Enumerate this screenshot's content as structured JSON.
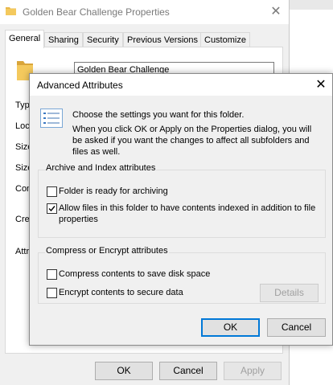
{
  "background_window": {
    "title": "Golden Bear Challenge Properties",
    "close_glyph": "✕",
    "tabs": [
      "General",
      "Sharing",
      "Security",
      "Previous Versions",
      "Customize"
    ],
    "active_tab": "General",
    "folder_name": "Golden Bear Challenge",
    "side_labels": [
      "Typ",
      "Loc",
      "Size",
      "Size",
      "Con",
      "Cre",
      "Attr"
    ],
    "buttons": {
      "ok": "OK",
      "cancel": "Cancel",
      "apply": "Apply"
    }
  },
  "dialog": {
    "title": "Advanced Attributes",
    "close_glyph": "✕",
    "intro_line1": "Choose the settings you want for this folder.",
    "intro_line2": "When you click OK or Apply on the Properties dialog, you will be asked if you want the changes to affect all subfolders and files as well.",
    "archive_group": {
      "label": "Archive and Index attributes",
      "archive_label": "Folder is ready for archiving",
      "archive_checked": false,
      "index_label": "Allow files in this folder to have contents indexed in addition to file properties",
      "index_checked": true
    },
    "compress_group": {
      "label": "Compress or Encrypt attributes",
      "compress_label": "Compress contents to save disk space",
      "compress_checked": false,
      "encrypt_label": "Encrypt contents to secure data",
      "encrypt_checked": false,
      "details_label": "Details"
    },
    "ok_label": "OK",
    "cancel_label": "Cancel"
  },
  "colors": {
    "accent": "#0078d7",
    "folder": "#e8b84a",
    "window_bg": "#f0f0f0"
  },
  "icons": {
    "folder": "folder-icon",
    "info": "settings-list-icon",
    "check": "checkmark-icon"
  }
}
